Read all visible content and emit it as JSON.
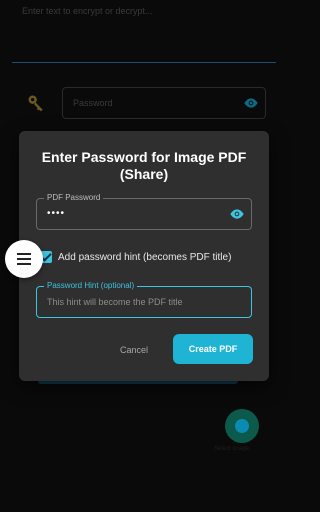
{
  "background": {
    "encrypt_placeholder": "Enter text to encrypt or decrypt...",
    "password_placeholder": "Password",
    "fab_label": "Select Image"
  },
  "dialog": {
    "title": "Enter Password for Image PDF (Share)",
    "password_label": "PDF Password",
    "password_value": "••••",
    "hint_checkbox_label": "Add password hint (becomes PDF title)",
    "hint_checked": true,
    "hint_label": "Password Hint (optional)",
    "hint_placeholder": "This hint will become the PDF title",
    "cancel_label": "Cancel",
    "create_label": "Create PDF"
  },
  "icons": {
    "key": "key-icon",
    "eye": "eye-icon",
    "menu": "menu-icon"
  },
  "colors": {
    "accent": "#1fb4d4",
    "dialog_bg": "#2f2f2f",
    "app_bg": "#0a0a0a"
  }
}
